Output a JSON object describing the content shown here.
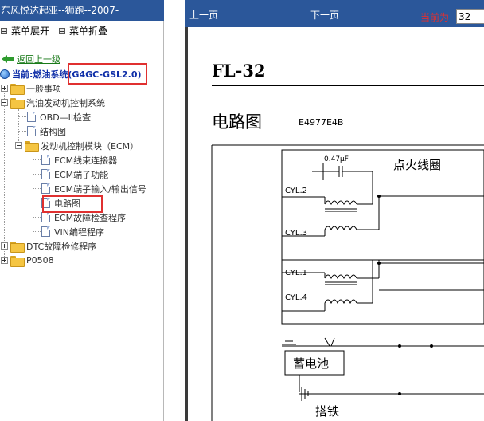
{
  "left": {
    "title": "东风悦达起亚--狮跑--2007-",
    "menu_expand": "菜单展开",
    "menu_collapse": "菜单折叠",
    "back": "返回上一级",
    "current_prefix": "当前:燃油系统",
    "current_model": "(G4GC-GSL2.0)",
    "tree": [
      {
        "label": "一般事项"
      },
      {
        "label": "汽油发动机控制系统"
      },
      {
        "label": "OBD—II检查"
      },
      {
        "label": "结构图"
      },
      {
        "label": "发动机控制模块（ECM）"
      },
      {
        "label": "ECM线束连接器"
      },
      {
        "label": "ECM端子功能"
      },
      {
        "label": "ECM端子输入/输出信号"
      },
      {
        "label": "电路图"
      },
      {
        "label": "ECM故障检查程序"
      },
      {
        "label": "VIN编程程序"
      },
      {
        "label": "DTC故障检修程序"
      },
      {
        "label": "P0508"
      }
    ]
  },
  "viewer": {
    "prev": "上一页",
    "next": "下一页",
    "current_label": "当前为",
    "page_value": "32"
  },
  "document": {
    "code": "FL-32",
    "heading": "电路图",
    "doc_id": "E4977E4B",
    "diagram": {
      "capacitor": "0.47μF",
      "ignition_coil": "点火线圈",
      "cyl2": "CYL.2",
      "cyl3": "CYL.3",
      "cyl1": "CYL.1",
      "cyl4": "CYL.4",
      "battery": "蓄电池",
      "ground": "搭铁"
    }
  }
}
